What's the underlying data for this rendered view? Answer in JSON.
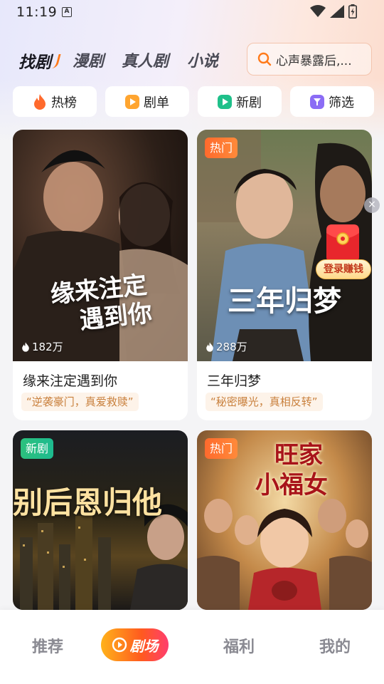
{
  "status_bar": {
    "time": "11:19",
    "notification_icon": "A",
    "icons": [
      "wifi-icon",
      "signal-icon",
      "battery-icon"
    ]
  },
  "top_nav": {
    "tabs": [
      {
        "label": "找剧",
        "active": true
      },
      {
        "label": "漫剧",
        "active": false
      },
      {
        "label": "真人剧",
        "active": false
      },
      {
        "label": "小说",
        "active": false
      }
    ],
    "search_placeholder": "心声暴露后,..."
  },
  "quick_buttons": [
    {
      "label": "热榜",
      "icon": "flame-icon",
      "color": "#ff6a2d"
    },
    {
      "label": "剧单",
      "icon": "play-list-icon",
      "color": "#ffa530"
    },
    {
      "label": "新剧",
      "icon": "play-icon",
      "color": "#1fc08a"
    },
    {
      "label": "筛选",
      "icon": "filter-icon",
      "color": "#8b6cf5"
    }
  ],
  "cards": [
    {
      "title": "缘来注定遇到你",
      "tag": "“逆袭豪门，真爱救赎”",
      "views": "182万",
      "badge": "",
      "poster_text": [
        "缘来注定",
        "遇到你"
      ]
    },
    {
      "title": "三年归梦",
      "tag": "“秘密曝光，真相反转”",
      "views": "288万",
      "badge": "热门",
      "poster_text": [
        "三年归梦"
      ]
    },
    {
      "title": "",
      "tag": "",
      "views": "",
      "badge": "新剧",
      "poster_text": [
        "别后恩归他"
      ]
    },
    {
      "title": "",
      "tag": "",
      "views": "",
      "badge": "热门",
      "poster_text": [
        "旺家",
        "小福女"
      ]
    }
  ],
  "promo": {
    "label": "登录赚钱",
    "close": "×"
  },
  "bottom_nav": {
    "items": [
      "推荐",
      "剧场",
      "福利",
      "我的"
    ],
    "active_index": 1
  },
  "colors": {
    "accent": "#ff6a2d",
    "tag_text": "#c9803d",
    "tag_bg": "#fdf3e9"
  }
}
